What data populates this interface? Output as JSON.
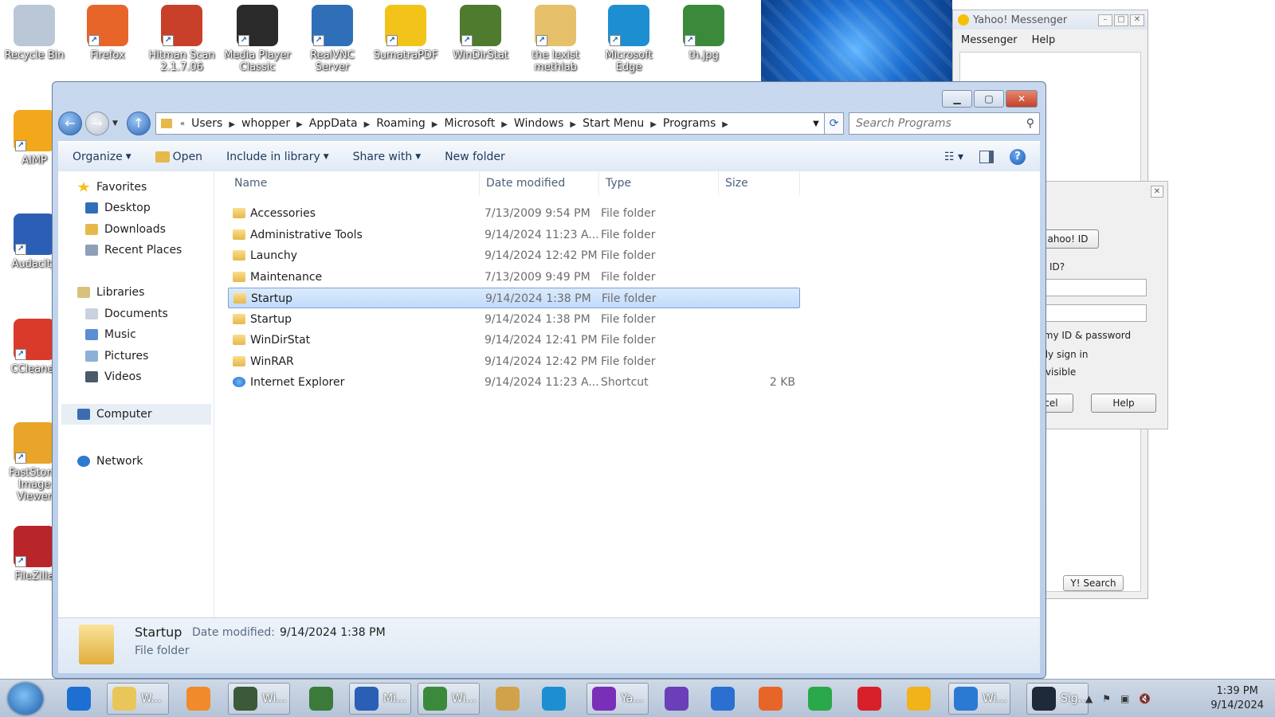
{
  "desktop": {
    "icons": [
      {
        "label": "Recycle Bin",
        "color": "#b9c7d6"
      },
      {
        "label": "Firefox",
        "color": "#e8652a"
      },
      {
        "label": "Hitman Scan 2.1.7.06",
        "color": "#c8402a"
      },
      {
        "label": "Media Player Classic",
        "color": "#2a2a2a"
      },
      {
        "label": "RealVNC Server",
        "color": "#2f6fb8"
      },
      {
        "label": "SumatraPDF",
        "color": "#f2c41a"
      },
      {
        "label": "WinDirStat",
        "color": "#4e7b2e"
      },
      {
        "label": "the lexist methlab",
        "color": "#e6c06a"
      },
      {
        "label": "Microsoft Edge",
        "color": "#1d8fd1"
      },
      {
        "label": "th.jpg",
        "color": "#3b8a3b"
      },
      {
        "label": "AIMP",
        "color": "#f2a81a"
      },
      {
        "label": "Audacity",
        "color": "#2b5fb6"
      },
      {
        "label": "CCleaner",
        "color": "#d93a2a"
      },
      {
        "label": "FastStone Image Viewer",
        "color": "#e8a52a"
      },
      {
        "label": "FileZilla",
        "color": "#b8262a"
      }
    ]
  },
  "yahoo": {
    "title": "Yahoo! Messenger",
    "menu": [
      "Messenger",
      "Help"
    ],
    "dialog": {
      "id_button": "ahoo! ID",
      "id_prompt": "o! ID?",
      "remember": "r my ID & password",
      "auto_sign_in": "ally sign in",
      "invisible": "invisible",
      "cancel": "cel",
      "help": "Help"
    },
    "search_button": "Y! Search"
  },
  "explorer": {
    "breadcrumb": [
      "Users",
      "whopper",
      "AppData",
      "Roaming",
      "Microsoft",
      "Windows",
      "Start Menu",
      "Programs"
    ],
    "search_placeholder": "Search Programs",
    "toolbar": {
      "organize": "Organize",
      "open": "Open",
      "include_in_library": "Include in library",
      "share_with": "Share with",
      "new_folder": "New folder"
    },
    "nav": {
      "favorites": "Favorites",
      "desktop": "Desktop",
      "downloads": "Downloads",
      "recent_places": "Recent Places",
      "libraries": "Libraries",
      "documents": "Documents",
      "music": "Music",
      "pictures": "Pictures",
      "videos": "Videos",
      "computer": "Computer",
      "network": "Network"
    },
    "columns": {
      "name": "Name",
      "date": "Date modified",
      "type": "Type",
      "size": "Size"
    },
    "files": [
      {
        "name": "Accessories",
        "date": "7/13/2009 9:54 PM",
        "type": "File folder",
        "size": ""
      },
      {
        "name": "Administrative Tools",
        "date": "9/14/2024 11:23 A...",
        "type": "File folder",
        "size": ""
      },
      {
        "name": "Launchy",
        "date": "9/14/2024 12:42 PM",
        "type": "File folder",
        "size": ""
      },
      {
        "name": "Maintenance",
        "date": "7/13/2009 9:49 PM",
        "type": "File folder",
        "size": ""
      },
      {
        "name": "Startup",
        "date": "9/14/2024 1:38 PM",
        "type": "File folder",
        "size": "",
        "selected": true
      },
      {
        "name": "Startup",
        "date": "9/14/2024 1:38 PM",
        "type": "File folder",
        "size": ""
      },
      {
        "name": "WinDirStat",
        "date": "9/14/2024 12:41 PM",
        "type": "File folder",
        "size": ""
      },
      {
        "name": "WinRAR",
        "date": "9/14/2024 12:42 PM",
        "type": "File folder",
        "size": ""
      },
      {
        "name": "Internet Explorer",
        "date": "9/14/2024 11:23 A...",
        "type": "Shortcut",
        "size": "2 KB"
      }
    ],
    "details": {
      "name": "Startup",
      "date_label": "Date modified:",
      "date_value": "9/14/2024 1:38 PM",
      "type": "File folder"
    }
  },
  "taskbar": {
    "items": [
      {
        "label": "",
        "color": "#1d6fd1"
      },
      {
        "label": "W...",
        "color": "#e8c65a"
      },
      {
        "label": "",
        "color": "#f08a2a"
      },
      {
        "label": "Wi...",
        "color": "#3a5a3a"
      },
      {
        "label": "",
        "color": "#3b7a3b"
      },
      {
        "label": "Mi...",
        "color": "#2b5fb6"
      },
      {
        "label": "Wi...",
        "color": "#3b8a3b"
      },
      {
        "label": "",
        "color": "#d2a24a"
      },
      {
        "label": "",
        "color": "#1d8fd1"
      },
      {
        "label": "Ya...",
        "color": "#7b2fb8"
      },
      {
        "label": "",
        "color": "#6a3fb8"
      },
      {
        "label": "",
        "color": "#2b6fd1"
      },
      {
        "label": "",
        "color": "#e8652a"
      },
      {
        "label": "",
        "color": "#2aa84a"
      },
      {
        "label": "",
        "color": "#d8202a"
      },
      {
        "label": "",
        "color": "#f2b21a"
      },
      {
        "label": "Wi...",
        "color": "#2b7ad1"
      },
      {
        "label": "Sig...",
        "color": "#1e2a3a"
      }
    ],
    "time": "1:39 PM",
    "date": "9/14/2024"
  }
}
